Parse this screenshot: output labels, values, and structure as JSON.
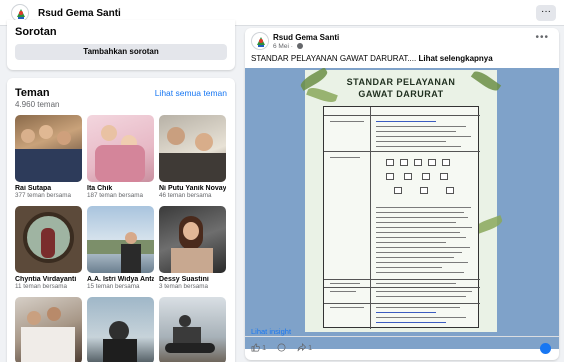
{
  "header": {
    "title": "Rsud Gema Santi",
    "more_label": "···"
  },
  "sorotan": {
    "title": "Sorotan",
    "add_label": "Tambahkan sorotan"
  },
  "friends": {
    "title": "Teman",
    "see_all": "Lihat semua teman",
    "count": "4.960 teman",
    "items": [
      {
        "name": "Rai Sutapa",
        "mutual": "377 teman bersama"
      },
      {
        "name": "Ita Chik",
        "mutual": "187 teman bersama"
      },
      {
        "name": "Ni Putu Yanik Novayanti",
        "mutual": "46 teman bersama"
      },
      {
        "name": "Chyntia Virdayanti",
        "mutual": "11 teman bersama"
      },
      {
        "name": "A.A. Istri Widya Antari",
        "mutual": "15 teman bersama"
      },
      {
        "name": "Dessy Suastini",
        "mutual": "3 teman bersama"
      },
      {
        "name": "",
        "mutual": ""
      },
      {
        "name": "",
        "mutual": ""
      },
      {
        "name": "",
        "mutual": ""
      }
    ]
  },
  "post": {
    "author": "Rsud Gema Santi",
    "date": "6 Mei ·",
    "caption": "STANDAR PELAYANAN GAWAT DARURAT....",
    "see_more": "Lihat selengkapnya",
    "poster_title_1": "STANDAR PELAYANAN",
    "poster_title_2": "GAWAT DARURAT",
    "insight": "Lihat insight",
    "likes": "1",
    "shares": "1"
  },
  "colors": {
    "accent": "#1877f2",
    "secondary_text": "#65676b",
    "poster_bg": "#7fa2c9"
  }
}
